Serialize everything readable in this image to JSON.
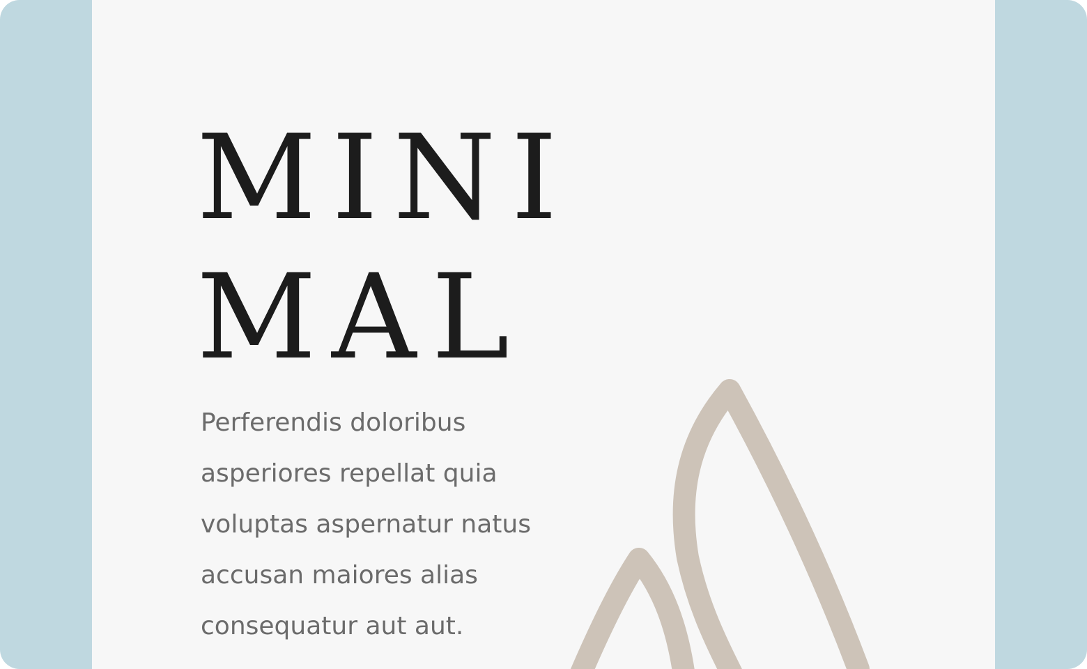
{
  "poster": {
    "title_lines": [
      "MINI",
      "MAL"
    ],
    "body_lines": [
      "Perferendis doloribus",
      "asperiores repellat quia",
      "voluptas aspernatur natus",
      "accusan maiores alias",
      "consequatur aut aut."
    ]
  },
  "colors": {
    "frame_background": "#bfd8e0",
    "poster_background": "#f7f7f7",
    "title_text": "#1c1c1c",
    "body_text": "#6b6b6b",
    "leaf_outline": "#cdc3b8"
  },
  "art": {
    "icon": "leaf-outline-illustration"
  }
}
